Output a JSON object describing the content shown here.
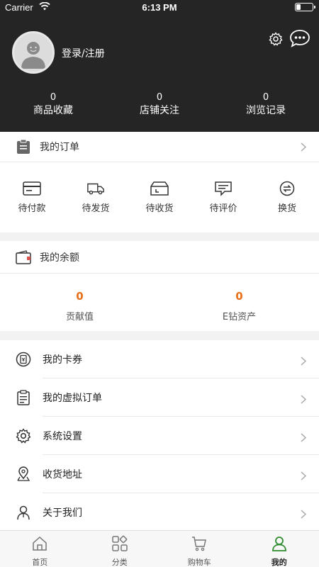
{
  "status_bar": {
    "carrier": "Carrier",
    "time": "6:13 PM"
  },
  "header": {
    "login_label": "登录/注册",
    "stats": [
      {
        "value": "0",
        "label": "商品收藏"
      },
      {
        "value": "0",
        "label": "店铺关注"
      },
      {
        "value": "0",
        "label": "浏览记录"
      }
    ]
  },
  "orders": {
    "title": "我的订单",
    "items": [
      {
        "label": "待付款",
        "icon": "card-icon"
      },
      {
        "label": "待发货",
        "icon": "truck-icon"
      },
      {
        "label": "待收货",
        "icon": "box-icon"
      },
      {
        "label": "待评价",
        "icon": "comment-icon"
      },
      {
        "label": "换货",
        "icon": "exchange-icon"
      }
    ]
  },
  "balance": {
    "title": "我的余额",
    "items": [
      {
        "value": "0",
        "label": "贡献值"
      },
      {
        "value": "0",
        "label": "E钻资产"
      }
    ],
    "value_color": "#e8701a"
  },
  "menu": [
    {
      "label": "我的卡券",
      "icon": "coupon-icon"
    },
    {
      "label": "我的虚拟订单",
      "icon": "clipboard-icon"
    },
    {
      "label": "系统设置",
      "icon": "gear-icon"
    },
    {
      "label": "收货地址",
      "icon": "location-icon"
    },
    {
      "label": "关于我们",
      "icon": "person-icon"
    }
  ],
  "tabbar": [
    {
      "label": "首页",
      "icon": "home-icon"
    },
    {
      "label": "分类",
      "icon": "category-icon"
    },
    {
      "label": "购物车",
      "icon": "cart-icon"
    },
    {
      "label": "我的",
      "icon": "user-icon",
      "active": true
    }
  ],
  "colors": {
    "header_bg": "#252525",
    "accent": "#e8701a",
    "active_tab": "#2e8b2e"
  }
}
